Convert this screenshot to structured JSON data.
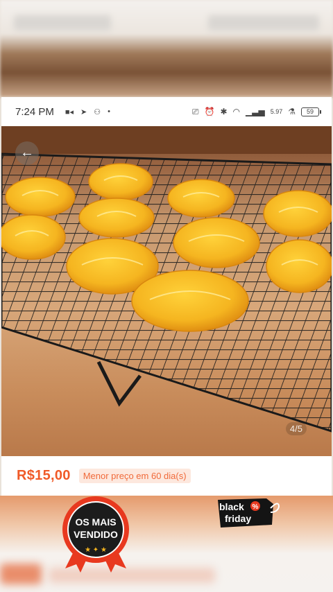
{
  "status_bar": {
    "time": "7:24 PM",
    "network_speed": "5.97",
    "battery": "59"
  },
  "product": {
    "image_counter": "4/5",
    "price": "R$15,00",
    "lowest_price_note": "Menor preço em 60 dia(s)"
  },
  "overlays": {
    "badge_line1": "OS MAIS",
    "badge_line2": "VENDIDO",
    "sticker_line1": "black",
    "sticker_line2": "friday",
    "sticker_mark": "%"
  },
  "colors": {
    "price": "#f05a28",
    "badge_red": "#e8391f",
    "badge_dark": "#1c1c1c",
    "cookie": "#f5b520"
  },
  "icons": [
    "video-icon",
    "send-icon",
    "group-icon",
    "dot-icon",
    "cast-icon",
    "alarm-icon",
    "bluetooth-icon",
    "wifi-icon",
    "signal-icon",
    "battery-icon",
    "back-arrow-icon"
  ]
}
